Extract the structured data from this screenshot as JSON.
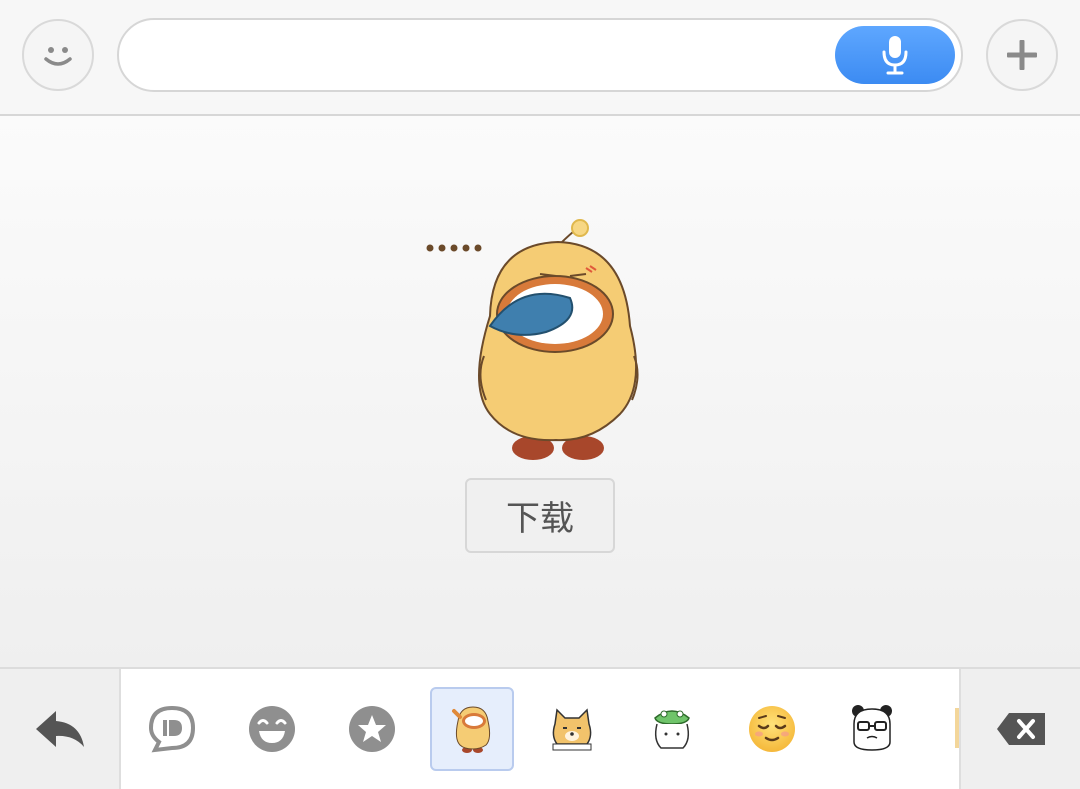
{
  "input_bar": {
    "emoji_toggle_icon": "smiley-face-icon",
    "text_value": "",
    "voice_icon": "microphone-icon",
    "more_icon": "plus-icon",
    "accent_color": "#4a98f8"
  },
  "preview": {
    "sticker": "yellow-chick-crying-sticker",
    "download_label": "下载"
  },
  "tray": {
    "back_icon": "reply-arrow-icon",
    "delete_icon": "backspace-icon",
    "tabs": [
      {
        "icon": "speech-bubble-icon",
        "selected": false
      },
      {
        "icon": "grinning-face-icon",
        "selected": false
      },
      {
        "icon": "star-icon",
        "selected": false
      },
      {
        "icon": "yellow-chick-sticker-pack",
        "selected": true
      },
      {
        "icon": "shiba-dog-sticker-pack",
        "selected": false
      },
      {
        "icon": "frog-hat-sticker-pack",
        "selected": false
      },
      {
        "icon": "relieved-face-emoji",
        "selected": false
      },
      {
        "icon": "panda-glasses-sticker-pack",
        "selected": false
      }
    ]
  }
}
